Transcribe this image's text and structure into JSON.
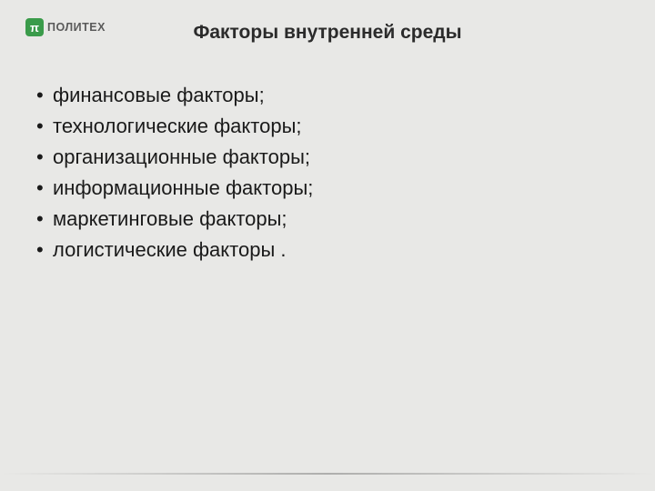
{
  "logo": {
    "mark": "π",
    "text": "ПОЛИТЕХ"
  },
  "title": "Факторы внутренней среды",
  "bullets": [
    "финансовые факторы;",
    "технологические факторы;",
    "организационные факторы;",
    "информационные факторы;",
    "маркетинговые факторы;",
    "логистические факторы ."
  ]
}
